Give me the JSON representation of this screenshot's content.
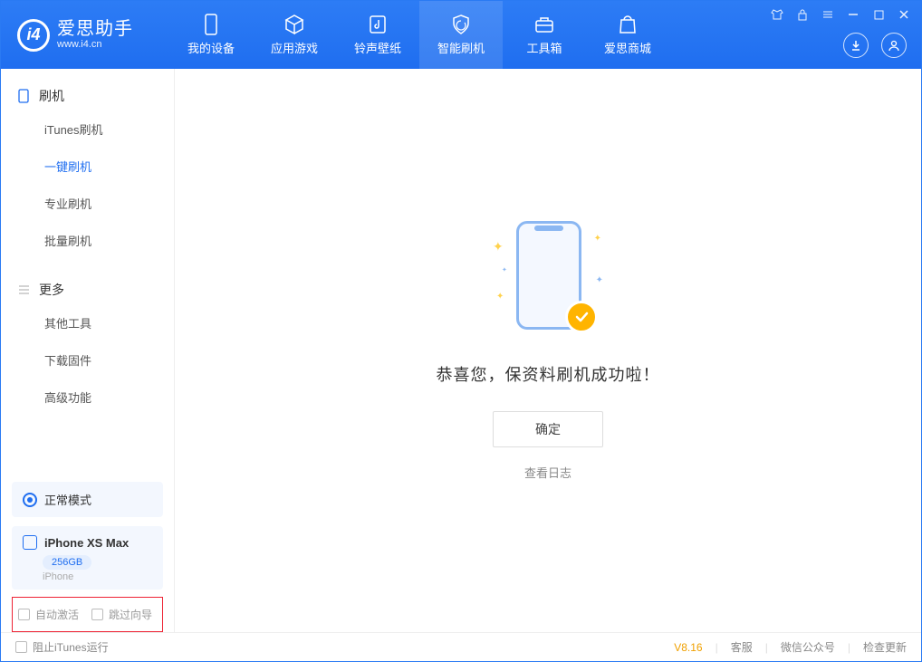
{
  "app": {
    "name_cn": "爱思助手",
    "name_en": "www.i4.cn"
  },
  "nav": {
    "items": [
      {
        "label": "我的设备",
        "icon": "device-icon"
      },
      {
        "label": "应用游戏",
        "icon": "cube-icon"
      },
      {
        "label": "铃声壁纸",
        "icon": "music-icon"
      },
      {
        "label": "智能刷机",
        "icon": "shield-icon",
        "active": true
      },
      {
        "label": "工具箱",
        "icon": "toolbox-icon"
      },
      {
        "label": "爱思商城",
        "icon": "bag-icon"
      }
    ]
  },
  "sidebar": {
    "section1": {
      "title": "刷机",
      "items": [
        {
          "label": "iTunes刷机"
        },
        {
          "label": "一键刷机",
          "active": true
        },
        {
          "label": "专业刷机"
        },
        {
          "label": "批量刷机"
        }
      ]
    },
    "section2": {
      "title": "更多",
      "items": [
        {
          "label": "其他工具"
        },
        {
          "label": "下载固件"
        },
        {
          "label": "高级功能"
        }
      ]
    },
    "mode_label": "正常模式",
    "device": {
      "name": "iPhone XS Max",
      "storage": "256GB",
      "type": "iPhone"
    },
    "options": {
      "auto_activate": "自动激活",
      "skip_guide": "跳过向导"
    }
  },
  "main": {
    "success_msg": "恭喜您，保资料刷机成功啦！",
    "ok_btn": "确定",
    "log_link": "查看日志"
  },
  "status": {
    "block_itunes": "阻止iTunes运行",
    "version": "V8.16",
    "links": {
      "cs": "客服",
      "wechat": "微信公众号",
      "update": "检查更新"
    }
  }
}
